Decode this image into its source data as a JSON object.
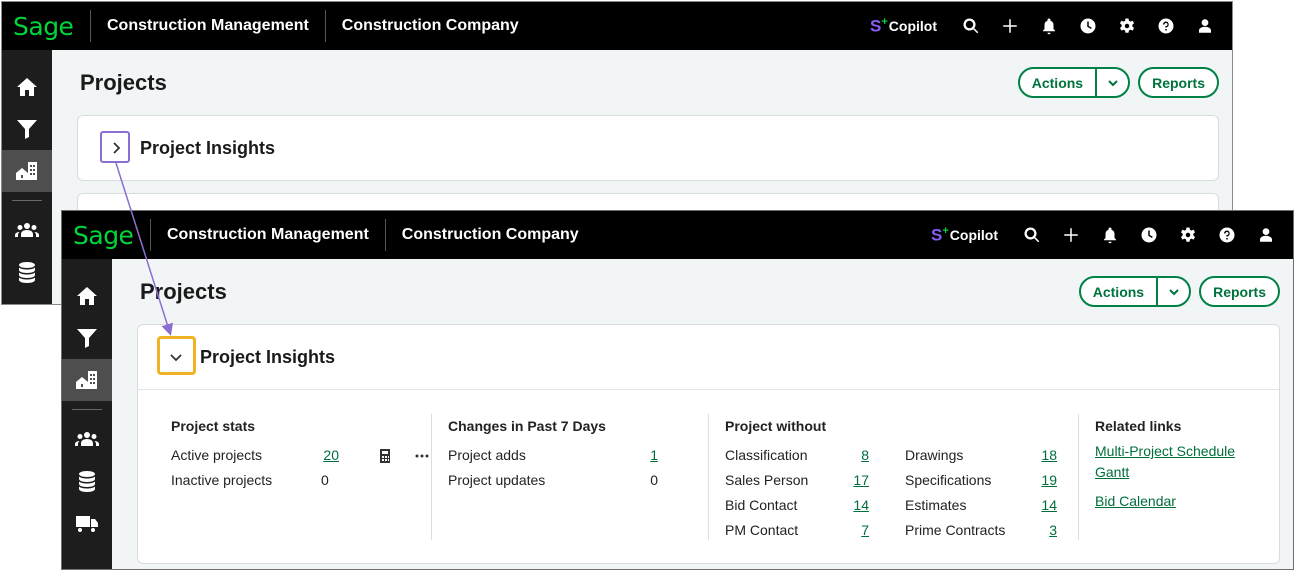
{
  "app": {
    "logo": "Sage",
    "product": "Construction Management",
    "company": "Construction Company",
    "copilot_label": "Copilot"
  },
  "page": {
    "title": "Projects",
    "actions_label": "Actions",
    "reports_label": "Reports"
  },
  "insights": {
    "title": "Project Insights",
    "project_stats": {
      "heading": "Project stats",
      "rows": [
        {
          "label": "Active projects",
          "value": "20"
        },
        {
          "label": "Inactive projects",
          "value": "0"
        }
      ]
    },
    "changes": {
      "heading": "Changes in Past 7 Days",
      "rows": [
        {
          "label": "Project adds",
          "value": "1"
        },
        {
          "label": "Project updates",
          "value": "0"
        }
      ]
    },
    "without": {
      "heading": "Project without",
      "left": [
        {
          "label": "Classification",
          "value": "8"
        },
        {
          "label": "Sales Person",
          "value": "17"
        },
        {
          "label": "Bid Contact",
          "value": "14"
        },
        {
          "label": "PM Contact",
          "value": "7"
        }
      ],
      "right": [
        {
          "label": "Drawings",
          "value": "18"
        },
        {
          "label": "Specifications",
          "value": "19"
        },
        {
          "label": "Estimates",
          "value": "14"
        },
        {
          "label": "Prime Contracts",
          "value": "3"
        }
      ]
    },
    "related": {
      "heading": "Related links",
      "link1_line1": "Multi-Project Schedule",
      "link1_line2": "Gantt",
      "link2": "Bid Calendar"
    }
  },
  "colors": {
    "brand_green": "#00d639",
    "link_green": "#006e3b",
    "callout_purple": "#8a6fd1",
    "callout_orange": "#f0b323"
  }
}
